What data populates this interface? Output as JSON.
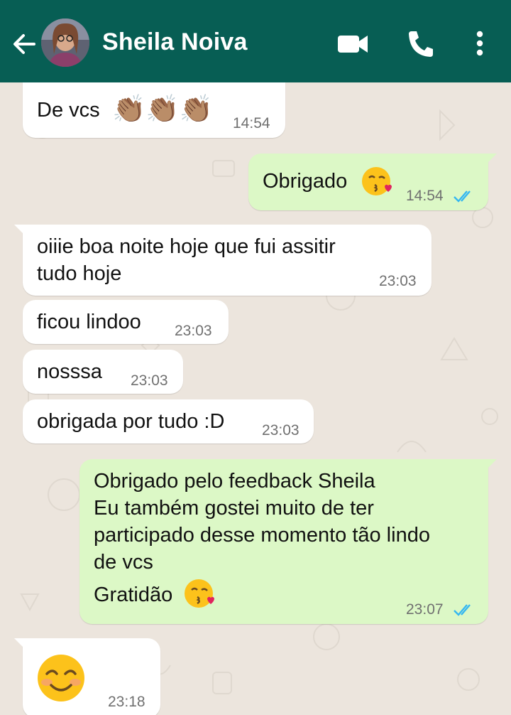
{
  "header": {
    "contact_name": "Sheila Noiva",
    "icons": [
      "back-arrow-icon",
      "avatar",
      "video-call-icon",
      "voice-call-icon",
      "more-options-icon"
    ]
  },
  "colors": {
    "header_bg": "#075e54",
    "chat_bg": "#ece5dd",
    "incoming_bubble": "#ffffff",
    "outgoing_bubble": "#dcf8c6",
    "read_ticks": "#34b7f1"
  },
  "messages": [
    {
      "direction": "incoming",
      "text": "De vcs",
      "emojis": "👏🏽👏🏽👏🏽",
      "time": "14:54"
    },
    {
      "direction": "outgoing",
      "text": "Obrigado",
      "emojis": "😘",
      "time": "14:54",
      "status": "read"
    },
    {
      "direction": "incoming",
      "text": "oiiie boa noite hoje que fui assitir\ntudo hoje",
      "time": "23:03"
    },
    {
      "direction": "incoming",
      "text": "ficou lindoo",
      "time": "23:03"
    },
    {
      "direction": "incoming",
      "text": "nosssa",
      "time": "23:03"
    },
    {
      "direction": "incoming",
      "text": "obrigada por tudo :D",
      "time": "23:03"
    },
    {
      "direction": "outgoing",
      "text": "Obrigado pelo feedback Sheila\nEu também gostei muito de ter\nparticipado desse momento tão lindo\nde vcs",
      "text2": "Gratidão",
      "emojis": "😘",
      "time": "23:07",
      "status": "read"
    },
    {
      "direction": "incoming",
      "text": "",
      "emojis": "☺️",
      "time": "23:18"
    }
  ]
}
